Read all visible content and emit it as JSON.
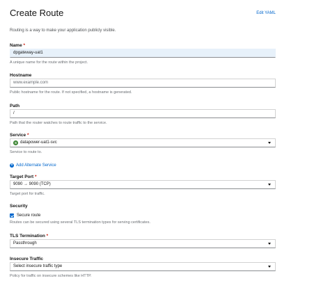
{
  "header": {
    "title": "Create Route",
    "edit_yaml": "Edit YAML"
  },
  "intro": "Routing is a way to make your application publicly visible.",
  "name": {
    "label": "Name",
    "required": "*",
    "value": "dpgateway-uat1",
    "helper": "A unique name for the route within the project."
  },
  "hostname": {
    "label": "Hostname",
    "placeholder": "www.example.com",
    "helper": "Public hostname for the route. If not specified, a hostname is generated."
  },
  "path": {
    "label": "Path",
    "value": "/",
    "helper": "Path that the router watches to route traffic to the service."
  },
  "service": {
    "label": "Service",
    "required": "*",
    "icon_letter": "S",
    "value": "datapower-uat1-svc",
    "helper": "Service to route to."
  },
  "add_alternate": {
    "label": "Add Alternate Service"
  },
  "target_port": {
    "label": "Target Port",
    "required": "*",
    "value": "9090 → 9090 (TCP)",
    "helper": "Target port for traffic."
  },
  "security": {
    "label": "Security",
    "checkbox_label": "Secure route",
    "checked": true,
    "helper": "Routes can be secured using several TLS termination types for serving certificates."
  },
  "tls": {
    "label": "TLS Termination",
    "required": "*",
    "value": "Passthrough"
  },
  "insecure": {
    "label": "Insecure Traffic",
    "value": "Select insecure traffic type",
    "helper": "Policy for traffic on insecure schemes like HTTP."
  },
  "colors": {
    "link": "#0066cc",
    "required": "#c9190b",
    "service_icon": "#3e8635"
  }
}
